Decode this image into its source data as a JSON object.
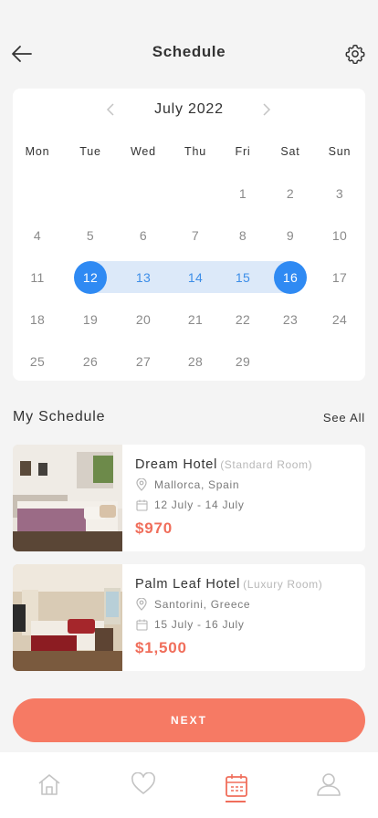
{
  "header": {
    "title": "Schedule"
  },
  "calendar": {
    "month": "July 2022",
    "weekdays": [
      "Mon",
      "Tue",
      "Wed",
      "Thu",
      "Fri",
      "Sat",
      "Sun"
    ],
    "leading_blanks": 4,
    "days_in_month": 29,
    "selected_start": 12,
    "selected_end": 16
  },
  "schedule": {
    "title": "My Schedule",
    "see_all": "See All",
    "bookings": [
      {
        "name": "Dream Hotel",
        "room": "(Standard Room)",
        "location": "Mallorca, Spain",
        "dates": "12 July - 14 July",
        "price": "$970"
      },
      {
        "name": "Palm Leaf Hotel",
        "room": "(Luxury Room)",
        "location": "Santorini, Greece",
        "dates": "15 July - 16 July",
        "price": "$1,500"
      }
    ]
  },
  "actions": {
    "next": "NEXT"
  },
  "colors": {
    "accent": "#f67a64",
    "price": "#f06e5b",
    "selected": "#2f8af3",
    "range": "#dce9f9"
  },
  "tabbar": {
    "items": [
      "home-icon",
      "heart-icon",
      "calendar-icon",
      "user-icon"
    ],
    "active": "calendar-icon"
  }
}
